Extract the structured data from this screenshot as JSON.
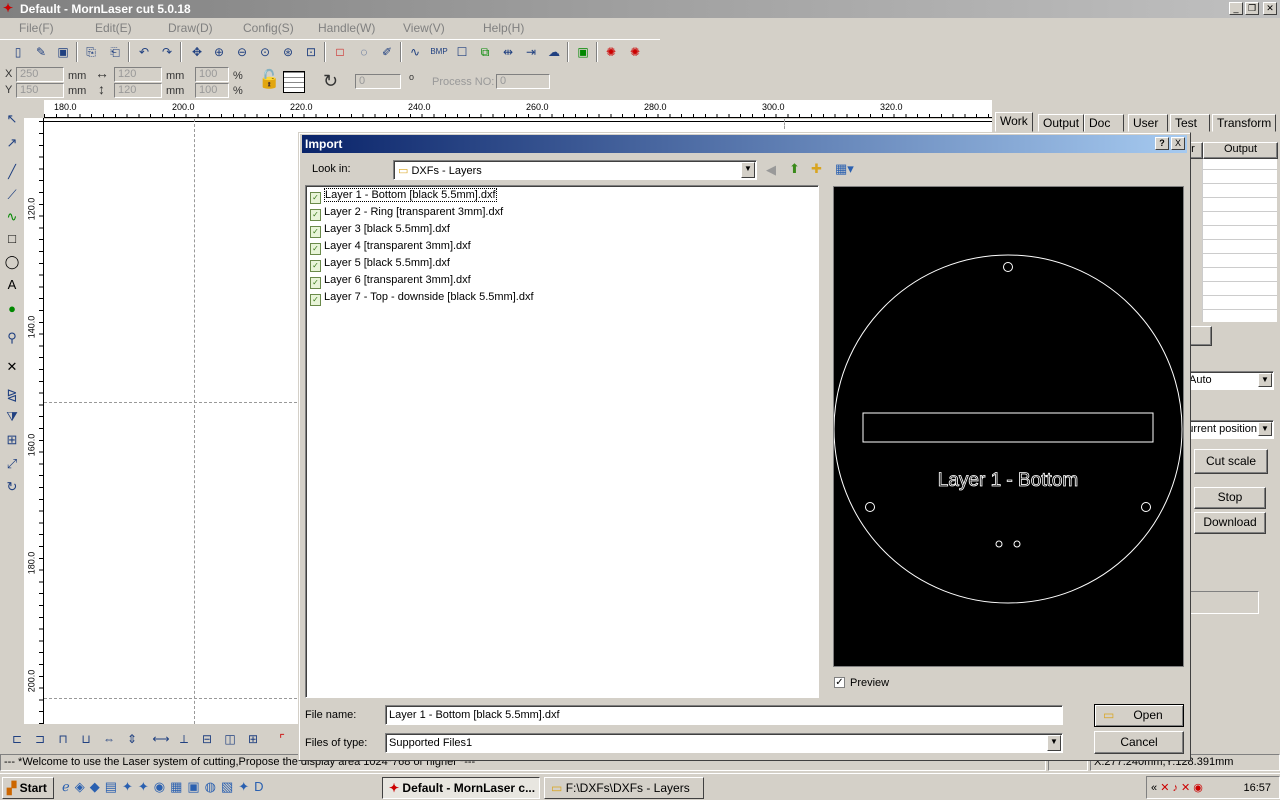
{
  "window": {
    "title": "Default - MornLaser cut 5.0.18"
  },
  "menu": [
    "File(F)",
    "Edit(E)",
    "Draw(D)",
    "Config(S)",
    "Handle(W)",
    "View(V)",
    "Help(H)"
  ],
  "props": {
    "x_label": "X",
    "y_label": "Y",
    "x": "250",
    "y": "150",
    "unit": "mm",
    "width": "120",
    "height": "120",
    "scale_x": "100",
    "scale_y": "100",
    "percent": "%",
    "rotation": "0",
    "degree": "o",
    "process_no_label": "Process NO:",
    "process_no": "0"
  },
  "ruler": {
    "h": [
      "180.0",
      "200.0",
      "220.0",
      "240.0",
      "260.0",
      "280.0",
      "300.0",
      "320.0"
    ],
    "v": [
      "120.0",
      "140.0",
      "160.0",
      "180.0",
      "200.0"
    ]
  },
  "right_panel": {
    "tabs": [
      "Work",
      "Output",
      "Doc",
      "User",
      "Test",
      "Transform"
    ],
    "col_output": "Output",
    "col_r": "r",
    "mode_select": "Auto",
    "position_select": "Current position",
    "cut_scale": "Cut scale",
    "stop": "Stop",
    "download": "Download"
  },
  "dialog": {
    "title": "Import",
    "help": "?",
    "close": "X",
    "look_in_label": "Look in:",
    "look_in": "DXFs - Layers",
    "files": [
      "Layer 1 - Bottom [black 5.5mm].dxf",
      "Layer 2 - Ring [transparent 3mm].dxf",
      "Layer 3 [black 5.5mm].dxf",
      "Layer 4 [transparent 3mm].dxf",
      "Layer 5 [black 5.5mm].dxf",
      "Layer 6 [transparent 3mm].dxf",
      "Layer 7 - Top - downside [black 5.5mm].dxf"
    ],
    "selected_index": 0,
    "preview_text": "Layer 1 - Bottom",
    "preview_label": "Preview",
    "preview_checked": true,
    "file_name_label": "File name:",
    "file_name": "Layer 1 - Bottom [black 5.5mm].dxf",
    "files_of_type_label": "Files of type:",
    "files_of_type": "Supported Files1",
    "open": "Open",
    "cancel": "Cancel"
  },
  "status": {
    "message": "--- *Welcome to use the Laser system of cutting,Propose the display area 1024*768 or higher *---",
    "coords": "X:277.240mm,Y:128.391mm"
  },
  "taskbar": {
    "start": "Start",
    "tasks": [
      "Default - MornLaser c...",
      "F:\\DXFs\\DXFs - Layers"
    ],
    "clock": "16:57"
  }
}
